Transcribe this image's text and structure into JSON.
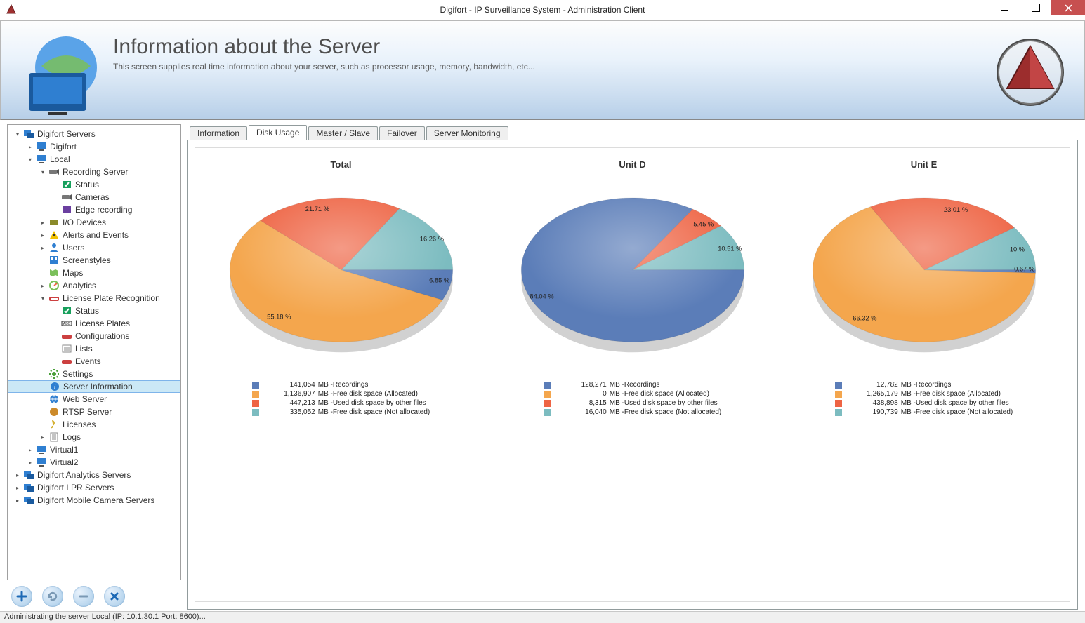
{
  "window": {
    "title": "Digifort - IP Surveillance System - Administration Client"
  },
  "banner": {
    "heading": "Information about the Server",
    "sub": "This screen supplies real time information about your server, such as processor usage, memory, bandwidth, etc..."
  },
  "tree": [
    {
      "d": 0,
      "tw": "▾",
      "icon": "server-group",
      "label": "Digifort Servers"
    },
    {
      "d": 1,
      "tw": "▸",
      "icon": "monitor",
      "label": "Digifort"
    },
    {
      "d": 1,
      "tw": "▾",
      "icon": "monitor",
      "label": "Local"
    },
    {
      "d": 2,
      "tw": "▾",
      "icon": "camera",
      "label": "Recording Server"
    },
    {
      "d": 3,
      "tw": "",
      "icon": "status",
      "label": "Status"
    },
    {
      "d": 3,
      "tw": "",
      "icon": "camera",
      "label": "Cameras"
    },
    {
      "d": 3,
      "tw": "",
      "icon": "edge",
      "label": "Edge recording"
    },
    {
      "d": 2,
      "tw": "▸",
      "icon": "io",
      "label": "I/O Devices"
    },
    {
      "d": 2,
      "tw": "▸",
      "icon": "alert",
      "label": "Alerts and Events"
    },
    {
      "d": 2,
      "tw": "▸",
      "icon": "users",
      "label": "Users"
    },
    {
      "d": 2,
      "tw": "",
      "icon": "screen",
      "label": "Screenstyles"
    },
    {
      "d": 2,
      "tw": "",
      "icon": "map",
      "label": "Maps"
    },
    {
      "d": 2,
      "tw": "▸",
      "icon": "analytics",
      "label": "Analytics"
    },
    {
      "d": 2,
      "tw": "▾",
      "icon": "lpr",
      "label": "License Plate Recognition"
    },
    {
      "d": 3,
      "tw": "",
      "icon": "status",
      "label": "Status"
    },
    {
      "d": 3,
      "tw": "",
      "icon": "plates",
      "label": "License Plates"
    },
    {
      "d": 3,
      "tw": "",
      "icon": "config",
      "label": "Configurations"
    },
    {
      "d": 3,
      "tw": "",
      "icon": "list",
      "label": "Lists"
    },
    {
      "d": 3,
      "tw": "",
      "icon": "events",
      "label": "Events"
    },
    {
      "d": 2,
      "tw": "",
      "icon": "settings",
      "label": "Settings"
    },
    {
      "d": 2,
      "tw": "",
      "icon": "info",
      "label": "Server Information",
      "sel": true
    },
    {
      "d": 2,
      "tw": "",
      "icon": "web",
      "label": "Web Server"
    },
    {
      "d": 2,
      "tw": "",
      "icon": "rtsp",
      "label": "RTSP Server"
    },
    {
      "d": 2,
      "tw": "",
      "icon": "license",
      "label": "Licenses"
    },
    {
      "d": 2,
      "tw": "▸",
      "icon": "logs",
      "label": "Logs"
    },
    {
      "d": 1,
      "tw": "▸",
      "icon": "monitor",
      "label": "Virtual1"
    },
    {
      "d": 1,
      "tw": "▸",
      "icon": "monitor",
      "label": "Virtual2"
    },
    {
      "d": 0,
      "tw": "▸",
      "icon": "server-group",
      "label": "Digifort Analytics Servers"
    },
    {
      "d": 0,
      "tw": "▸",
      "icon": "server-group",
      "label": "Digifort LPR Servers"
    },
    {
      "d": 0,
      "tw": "▸",
      "icon": "server-group",
      "label": "Digifort Mobile Camera Servers"
    }
  ],
  "tabs": [
    "Information",
    "Disk Usage",
    "Master / Slave",
    "Failover",
    "Server Monitoring"
  ],
  "active_tab": 1,
  "legend_series": [
    {
      "color": "#5b7db8",
      "name": "Recordings"
    },
    {
      "color": "#f4a64d",
      "name": "Free disk space (Allocated)"
    },
    {
      "color": "#ee6444",
      "name": "Used disk space by other files"
    },
    {
      "color": "#7cbcc0",
      "name": "Free disk space (Not allocated)"
    }
  ],
  "chart_data": [
    {
      "type": "pie",
      "title": "Total",
      "unit": "MB",
      "slices": [
        {
          "label": "Recordings",
          "value": 141054,
          "pct": 6.85,
          "color": "#5b7db8"
        },
        {
          "label": "Free disk space (Allocated)",
          "value": 1136907,
          "pct": 55.18,
          "color": "#f4a64d"
        },
        {
          "label": "Used disk space by other files",
          "value": 447213,
          "pct": 21.71,
          "color": "#ee6444"
        },
        {
          "label": "Free disk space (Not allocated)",
          "value": 335052,
          "pct": 16.26,
          "color": "#7cbcc0"
        }
      ]
    },
    {
      "type": "pie",
      "title": "Unit D",
      "unit": "MB",
      "slices": [
        {
          "label": "Recordings",
          "value": 128271,
          "pct": 84.04,
          "color": "#5b7db8"
        },
        {
          "label": "Free disk space (Allocated)",
          "value": 0,
          "pct": 0,
          "color": "#f4a64d"
        },
        {
          "label": "Used disk space by other files",
          "value": 8315,
          "pct": 5.45,
          "color": "#ee6444"
        },
        {
          "label": "Free disk space (Not allocated)",
          "value": 16040,
          "pct": 10.51,
          "color": "#7cbcc0"
        }
      ]
    },
    {
      "type": "pie",
      "title": "Unit E",
      "unit": "MB",
      "slices": [
        {
          "label": "Recordings",
          "value": 12782,
          "pct": 0.67,
          "color": "#5b7db8"
        },
        {
          "label": "Free disk space (Allocated)",
          "value": 1265179,
          "pct": 66.32,
          "color": "#f4a64d"
        },
        {
          "label": "Used disk space by other files",
          "value": 438898,
          "pct": 23.01,
          "color": "#ee6444"
        },
        {
          "label": "Free disk space (Not allocated)",
          "value": 190739,
          "pct": 10.0,
          "color": "#7cbcc0"
        }
      ]
    }
  ],
  "status": "Administrating the server Local (IP: 10.1.30.1 Port: 8600)..."
}
